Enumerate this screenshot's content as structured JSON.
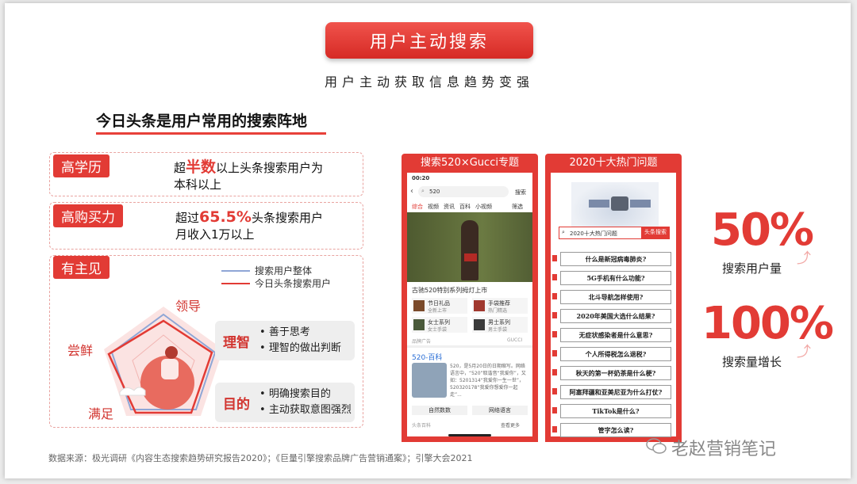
{
  "title": "用户主动搜索",
  "subtitle": "用户主动获取信息趋势变强",
  "section_title": "今日头条是用户常用的搜索阵地",
  "cards": [
    {
      "tag": "高学历",
      "pre": "超",
      "highlight": "半数",
      "post": "以上头条搜索用户为",
      "line2": "本科以上"
    },
    {
      "tag": "高购买力",
      "pre": "超过",
      "highlight": "65.5%",
      "post": "头条搜索用户",
      "line2": "月收入1万以上"
    }
  ],
  "opinion": {
    "tag": "有主见",
    "legend": [
      {
        "label": "搜索用户整体",
        "color": "#8fa6d6"
      },
      {
        "label": "今日头条搜索用户",
        "color": "#e23b35"
      }
    ],
    "vertices": {
      "top": "领导",
      "left": "尝鲜",
      "bottom": "满足"
    },
    "reason": {
      "title": "理智",
      "bullets": [
        "善于思考",
        "理智的做出判断"
      ]
    },
    "purpose": {
      "title": "目的",
      "bullets": [
        "明确搜索目的",
        "主动获取意图强烈"
      ]
    }
  },
  "phone1": {
    "header": "搜索520×Gucci专题",
    "time": "00:20",
    "query": "520",
    "search_btn": "搜索",
    "tabs": [
      "综合",
      "视频",
      "资讯",
      "百科",
      "小视频",
      "筛选"
    ],
    "caption": "古驰520特别系列拇灯上市",
    "products": [
      {
        "name": "节日礼品",
        "sub": "全新上市"
      },
      {
        "name": "手袋推荐",
        "sub": "热门精选"
      },
      {
        "name": "女士系列",
        "sub": "女士手袋"
      },
      {
        "name": "男士系列",
        "sub": "男士手袋"
      }
    ],
    "ad_left": "品牌广告",
    "ad_right": "GUCCI",
    "wiki_title": "520-百科",
    "wiki_text": "520，是5月20日的日期缩写。网络语言中，“520”取谐音“我爱你”，又如：5201314“我爱你一生一世”，520320178“我爱你想爱你一起走”...",
    "buttons": [
      "自然数数",
      "网络语言"
    ],
    "footer_left": "头条百科",
    "footer_right": "查看更多"
  },
  "phone2": {
    "header": "2020十大热门问题",
    "search_text": "2020十大热门问题",
    "search_btn": "头条搜索",
    "questions": [
      "什么是新冠病毒肺炎?",
      "5G手机有什么功能?",
      "北斗导航怎样使用?",
      "2020年美国大选什么结果?",
      "无症状感染者是什么意思?",
      "个人所得税怎么退税?",
      "秋天的第一杯奶茶是什么梗?",
      "阿塞拜疆和亚美尼亚为什么打仗?",
      "TikTok是什么?",
      "管字怎么读?"
    ]
  },
  "stats": [
    {
      "value": "50%",
      "label": "搜索用户量"
    },
    {
      "value": "100%",
      "label": "搜索量增长"
    }
  ],
  "footer": "数据来源：极光调研《内容生态搜索趋势研究报告2020》；《巨量引擎搜索品牌广告营销通案》；引擎大会2021",
  "watermark": "老赵营销笔记",
  "colors": {
    "accent": "#e23b35",
    "secondary": "#8fa6d6"
  },
  "icons": [
    "wechat-icon",
    "arrow-up-icon",
    "back-icon",
    "search-icon",
    "person-illustration"
  ]
}
